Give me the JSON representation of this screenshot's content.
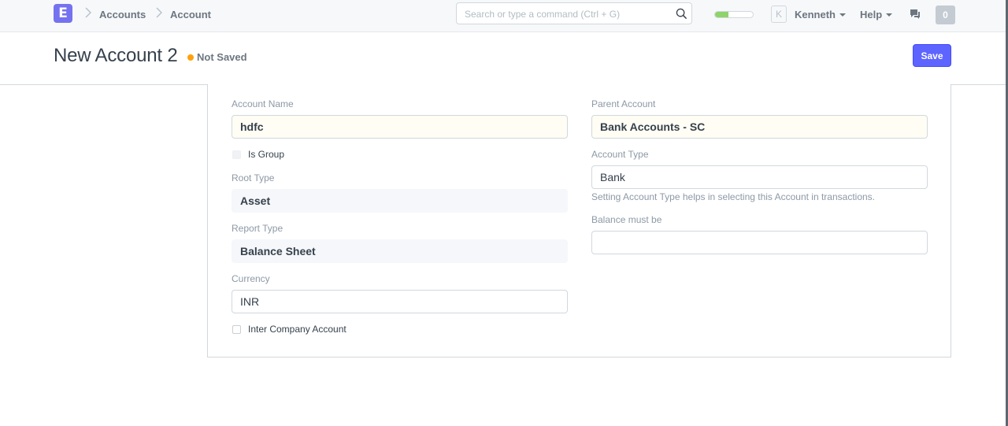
{
  "navbar": {
    "logo_letter": "E",
    "breadcrumbs": [
      "Accounts",
      "Account"
    ],
    "search_placeholder": "Search or type a command (Ctrl + G)",
    "setup_progress": 0.35,
    "user_initial": "K",
    "user_name": "Kenneth",
    "help_label": "Help",
    "notification_count": "0",
    "colors": {
      "logo": "#7572f0",
      "progress": "#8ed36b"
    }
  },
  "page": {
    "title": "New Account 2",
    "status": "Not Saved",
    "status_color": "#ffa00a",
    "save_label": "Save",
    "save_color": "#5e64ff"
  },
  "form": {
    "left": {
      "account_name": {
        "label": "Account Name",
        "value": "hdfc"
      },
      "is_group": {
        "label": "Is Group",
        "checked": false
      },
      "root_type": {
        "label": "Root Type",
        "value": "Asset"
      },
      "report_type": {
        "label": "Report Type",
        "value": "Balance Sheet"
      },
      "currency": {
        "label": "Currency",
        "value": "INR"
      },
      "inter_company": {
        "label": "Inter Company Account",
        "checked": false
      }
    },
    "right": {
      "parent_account": {
        "label": "Parent Account",
        "value": "Bank Accounts - SC"
      },
      "account_type": {
        "label": "Account Type",
        "value": "Bank",
        "help": "Setting Account Type helps in selecting this Account in transactions."
      },
      "balance_must_be": {
        "label": "Balance must be",
        "value": ""
      }
    }
  },
  "icons": [
    "logo-icon",
    "breadcrumb-chevron-icon",
    "search-icon",
    "chat-icon",
    "caret-down-icon",
    "status-dot-icon"
  ]
}
